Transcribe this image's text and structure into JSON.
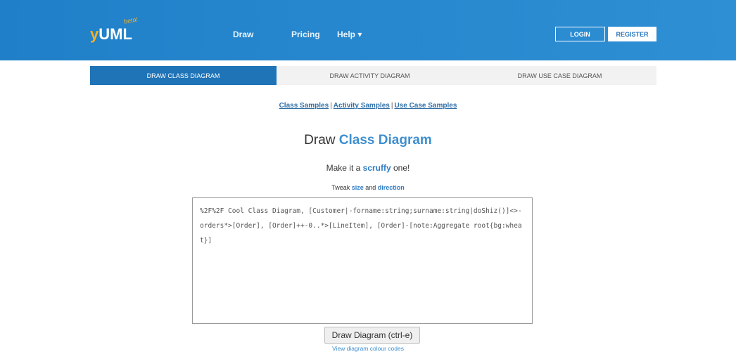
{
  "header": {
    "brand": {
      "y": "y",
      "rest": "UML",
      "beta": "beta!"
    },
    "nav": {
      "draw": "Draw",
      "pricing": "Pricing",
      "help": "Help ▾"
    },
    "auth": {
      "login": "LOGIN",
      "register": "REGISTER"
    }
  },
  "tabs": [
    {
      "label": "DRAW CLASS DIAGRAM"
    },
    {
      "label": "DRAW ACTIVITY DIAGRAM"
    },
    {
      "label": "DRAW USE CASE DIAGRAM"
    }
  ],
  "samples": {
    "class": "Class Samples",
    "activity": "Activity Samples",
    "usecase": "Use Case Samples",
    "sep": "|"
  },
  "title": {
    "prefix": "Draw ",
    "accent": "Class Diagram"
  },
  "scruffy": {
    "prefix": "Make it a ",
    "accent": "scruffy",
    "suffix": " one!"
  },
  "tweak": {
    "prefix": "Tweak ",
    "size": "size",
    "mid": " and ",
    "direction": "direction"
  },
  "editor": {
    "value": "%2F%2F Cool Class Diagram, [Customer|-forname:string;surname:string|doShiz()]<>-orders*>[Order], [Order]++-0..*>[LineItem], [Order]-[note:Aggregate root{bg:wheat}]"
  },
  "actions": {
    "draw_button": "Draw Diagram (ctrl-e)",
    "colour_codes": "View diagram colour codes"
  },
  "colors": {
    "header_bg": "#1f80c9",
    "accent": "#3f8fcf",
    "tab_active": "#1f73b7"
  }
}
